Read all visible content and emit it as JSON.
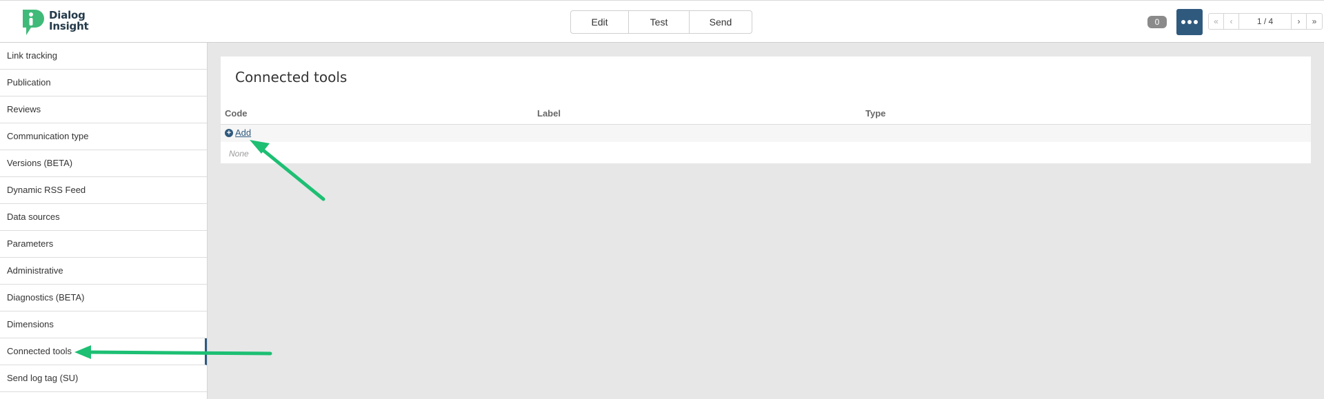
{
  "app": {
    "logo_text_line1": "Dialog",
    "logo_text_line2": "Insight"
  },
  "modes": {
    "edit": "Edit",
    "test": "Test",
    "send": "Send"
  },
  "header": {
    "badge_count": "0",
    "pager_label": "1 / 4",
    "pager_first": "«",
    "pager_prev": "‹",
    "pager_next": "›",
    "pager_last": "»"
  },
  "sidebar": {
    "items": [
      {
        "label": "Link tracking"
      },
      {
        "label": "Publication"
      },
      {
        "label": "Reviews"
      },
      {
        "label": "Communication type"
      },
      {
        "label": "Versions (BETA)"
      },
      {
        "label": "Dynamic RSS Feed"
      },
      {
        "label": "Data sources"
      },
      {
        "label": "Parameters"
      },
      {
        "label": "Administrative"
      },
      {
        "label": "Diagnostics (BETA)"
      },
      {
        "label": "Dimensions"
      },
      {
        "label": "Connected tools"
      },
      {
        "label": "Send log tag (SU)"
      }
    ]
  },
  "main": {
    "title": "Connected tools",
    "columns": [
      "Code",
      "Label",
      "Type"
    ],
    "add_label": "Add",
    "empty_text": "None"
  },
  "colors": {
    "accent": "#2f5a7e",
    "arrow": "#1dbf73",
    "logo_green": "#3fba79"
  }
}
